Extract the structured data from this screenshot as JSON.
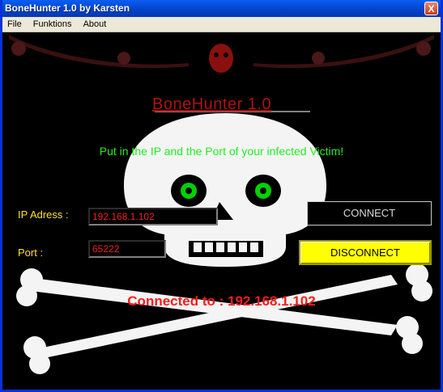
{
  "window": {
    "title": "BoneHunter 1.0 by Karsten",
    "close_glyph": "X"
  },
  "menu": [
    {
      "label": "File"
    },
    {
      "label": "Funktions"
    },
    {
      "label": "About"
    }
  ],
  "heading": "BoneHunter 1.0",
  "prompt": "Put in the IP and the Port of your infected Victim!",
  "form": {
    "ip_label": "IP Adress :",
    "ip_value": "192.168.1.102",
    "port_label": "Port :",
    "port_value": "65222"
  },
  "buttons": {
    "connect": "CONNECT",
    "disconnect": "DISCONNECT"
  },
  "status": "Connected to : 192.168.1.102",
  "colors": {
    "heading": "#b01010",
    "prompt": "#22ee22",
    "label": "#ffe227",
    "field_text": "#ee2020",
    "disconnect_bg": "#ffff00",
    "status": "#ff1a1a",
    "skull_eye": "#00d000"
  }
}
